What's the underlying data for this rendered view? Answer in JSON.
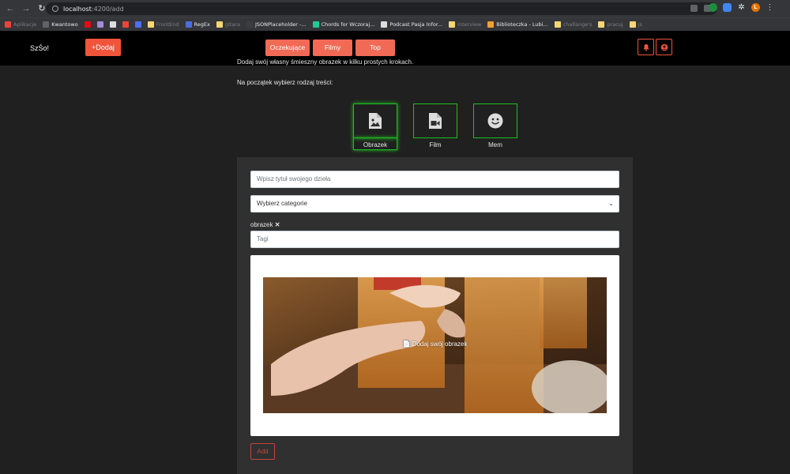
{
  "browser": {
    "url_host": "localhost",
    "url_path": ":4200/add",
    "bookmarks": [
      {
        "label": "Aplikacje",
        "dim": true,
        "color": "#e8453c"
      },
      {
        "label": "Kwantowo",
        "dim": false,
        "color": "#5f6368"
      },
      {
        "label": "",
        "dim": false,
        "color": "#e50914"
      },
      {
        "label": "",
        "dim": false,
        "color": "#a48bd4"
      },
      {
        "label": "",
        "dim": false,
        "color": "#dddddd"
      },
      {
        "label": "",
        "dim": false,
        "color": "#e8453c"
      },
      {
        "label": "",
        "dim": false,
        "color": "#4c6ef5"
      },
      {
        "label": "FrontEnd",
        "dim": true,
        "color": "#f7d774"
      },
      {
        "label": "RegEx",
        "dim": false,
        "color": "#4a6ee0"
      },
      {
        "label": "gitara",
        "dim": true,
        "color": "#f7d774"
      },
      {
        "label": "JSONPlaceholder -...",
        "dim": false,
        "color": "#3c3d41"
      },
      {
        "label": "Chords for Wczoraj...",
        "dim": false,
        "color": "#20c997"
      },
      {
        "label": "Podcast Pasja Infor...",
        "dim": false,
        "color": "#dddddd"
      },
      {
        "label": "interview",
        "dim": true,
        "color": "#f7d774"
      },
      {
        "label": "Biblioteczka - Lubi...",
        "dim": false,
        "color": "#f0a030"
      },
      {
        "label": "challange's",
        "dim": true,
        "color": "#f7d774"
      },
      {
        "label": "pracuj",
        "dim": true,
        "color": "#f7d774"
      },
      {
        "label": "js",
        "dim": true,
        "color": "#f7d774"
      }
    ],
    "avatar_letter": "L"
  },
  "navbar": {
    "brand": "SzŚo!",
    "add_button": "+Dodaj",
    "tabs": [
      "Oczekujące",
      "Filmy",
      "Top"
    ]
  },
  "page": {
    "intro_text": "Dodaj swój własny śmieszny obrazek w kilku prostych krokach.",
    "choose_text": "Na początek wybierz rodzaj treści:",
    "content_types": [
      {
        "label": "Obrazek",
        "icon": "image-file-icon",
        "selected": true
      },
      {
        "label": "Film",
        "icon": "video-file-icon",
        "selected": false
      },
      {
        "label": "Mem",
        "icon": "smile-icon",
        "selected": false
      }
    ],
    "form": {
      "title_placeholder": "Wpisz tytuł swojego dzieła",
      "category_value": "Wybierz categorie",
      "tag_chip": "obrazek",
      "tags_placeholder": "Tagi",
      "upload_label": "Dodaj swój obrazek",
      "add_button": "Add"
    }
  },
  "colors": {
    "accent": "#f0553c",
    "accent_light": "#f06a55",
    "selected_border": "#1fbf1f",
    "panel_bg": "#303030",
    "page_bg": "#202020"
  }
}
